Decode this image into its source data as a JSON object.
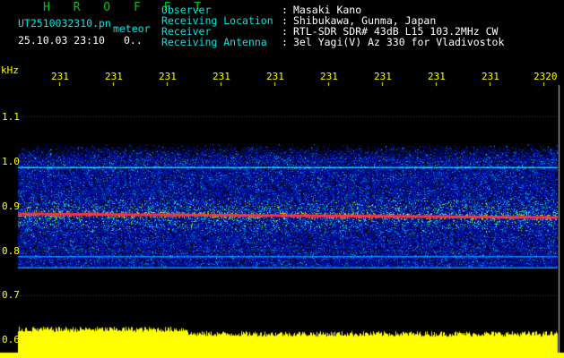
{
  "header": {
    "app_title": "H R O F F T",
    "file_name": "UT2510032310.pn",
    "mode": "meteor",
    "datetime": "25.10.03 23:10",
    "counter": "0..",
    "fields": [
      {
        "label": "Observer",
        "value": "Masaki Kano"
      },
      {
        "label": "Receiving Location",
        "value": "Shibukawa, Gunma, Japan"
      },
      {
        "label": "Receiver",
        "value": "RTL-SDR SDR# 43dB L15 103.2MHz CW"
      },
      {
        "label": "Receiving Antenna",
        "value": "3el Yagi(V) Az 330 for Vladivostok"
      }
    ],
    "separator": ":"
  },
  "chart_data": {
    "type": "heatmap",
    "ylabel": "kHz",
    "y_ticks": [
      "1.1",
      "1.0",
      "0.9",
      "0.8",
      "0.7",
      "0.6"
    ],
    "x_ticks": [
      "231",
      "231",
      "231",
      "231",
      "231",
      "231",
      "231",
      "231",
      "231",
      "2320"
    ],
    "ylim": [
      0.6,
      1.1
    ],
    "signal_lines_khz": [
      0.88,
      0.987,
      0.788,
      0.763
    ],
    "band_khz": [
      0.76,
      1.02
    ]
  },
  "colors": {
    "background": "#000000",
    "title": "#00c800",
    "labels": "#00e6e6",
    "values": "#ffffff",
    "axis": "#ffff00"
  }
}
